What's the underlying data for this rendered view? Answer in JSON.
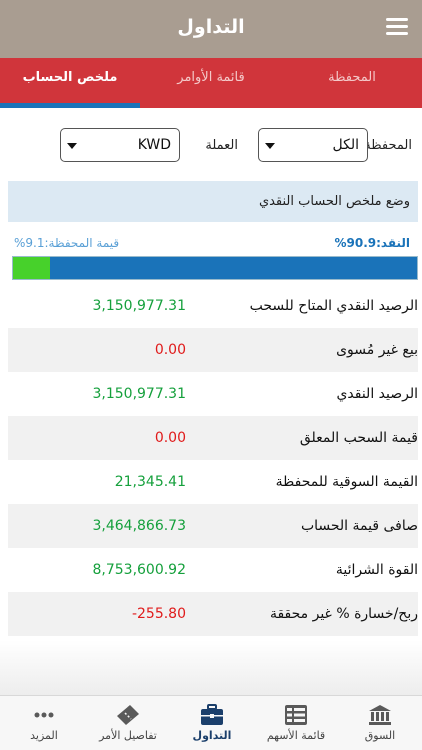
{
  "header": {
    "title": "التداول"
  },
  "tabs": [
    {
      "label": "ملخص الحساب"
    },
    {
      "label": "قائمة الأوامر"
    },
    {
      "label": "المحفظة"
    }
  ],
  "filters": {
    "portfolio_label": "المحفظة",
    "portfolio_value": "الكل",
    "currency_label": "العملة",
    "currency_value": "KWD"
  },
  "summary": {
    "title": "وضع ملخص الحساب النقدي",
    "cash_label": "النقد:90.9%",
    "portfolio_label": "قيمة المحفظة:9.1%",
    "portfolio_share": 0.091,
    "rows": [
      {
        "label": "الرصيد النقدي المتاح للسحب",
        "value": "3,150,977.31"
      },
      {
        "label": "بيع غير مُسوى",
        "value": "0.00"
      },
      {
        "label": "الرصيد النقدي",
        "value": "3,150,977.31"
      },
      {
        "label": "قيمة السحب المعلق",
        "value": "0.00"
      },
      {
        "label": "القيمة السوقية للمحفظة",
        "value": "21,345.41"
      },
      {
        "label": "صافى قيمة الحساب",
        "value": "3,464,866.73"
      },
      {
        "label": "القوة الشرائية",
        "value": "8,753,600.92"
      },
      {
        "label": "ربح/خسارة % غير محققة",
        "value": "-255.80"
      }
    ]
  },
  "colors": {
    "positive": "#15a03c",
    "negative": "#e01b1b",
    "accent": "#1a73b9",
    "tabbar": "#d0353b"
  },
  "nav": [
    {
      "label": "السوق",
      "icon": "bank-icon"
    },
    {
      "label": "قائمة الأسهم",
      "icon": "list-icon"
    },
    {
      "label": "التداول",
      "icon": "briefcase-icon"
    },
    {
      "label": "تفاصيل الأمر",
      "icon": "ticket-icon"
    },
    {
      "label": "المزيد",
      "icon": "more-icon"
    }
  ]
}
